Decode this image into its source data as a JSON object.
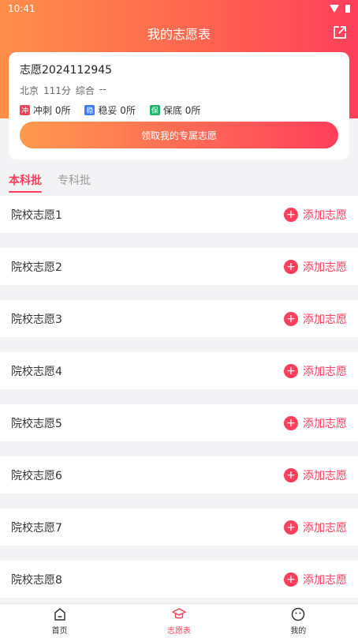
{
  "status_bar": {
    "time": "10:41"
  },
  "header": {
    "title": "我的志愿表"
  },
  "card": {
    "title": "志愿2024112945",
    "meta": {
      "region": "北京",
      "score": "111分",
      "subject": "综合",
      "extra": "--"
    },
    "counts": [
      {
        "tag": "冲",
        "label": "冲刺 0所",
        "color": "#ff3f5c"
      },
      {
        "tag": "稳",
        "label": "稳妥 0所",
        "color": "#3a7bff"
      },
      {
        "tag": "保",
        "label": "保底 0所",
        "color": "#22b36b"
      }
    ],
    "cta_label": "领取我的专属志愿"
  },
  "tabs": [
    {
      "label": "本科批",
      "active": true
    },
    {
      "label": "专科批",
      "active": false
    }
  ],
  "rows": [
    {
      "label": "院校志愿1",
      "action": "添加志愿"
    },
    {
      "label": "院校志愿2",
      "action": "添加志愿"
    },
    {
      "label": "院校志愿3",
      "action": "添加志愿"
    },
    {
      "label": "院校志愿4",
      "action": "添加志愿"
    },
    {
      "label": "院校志愿5",
      "action": "添加志愿"
    },
    {
      "label": "院校志愿6",
      "action": "添加志愿"
    },
    {
      "label": "院校志愿7",
      "action": "添加志愿"
    },
    {
      "label": "院校志愿8",
      "action": "添加志愿"
    }
  ],
  "bottom_nav": [
    {
      "label": "首页",
      "icon": "home-icon",
      "active": false
    },
    {
      "label": "志愿表",
      "icon": "graduation-cap-icon",
      "active": true
    },
    {
      "label": "我的",
      "icon": "smile-icon",
      "active": false
    }
  ],
  "colors": {
    "accent": "#ff3f5c",
    "gradient_start": "#ff8e4a"
  }
}
